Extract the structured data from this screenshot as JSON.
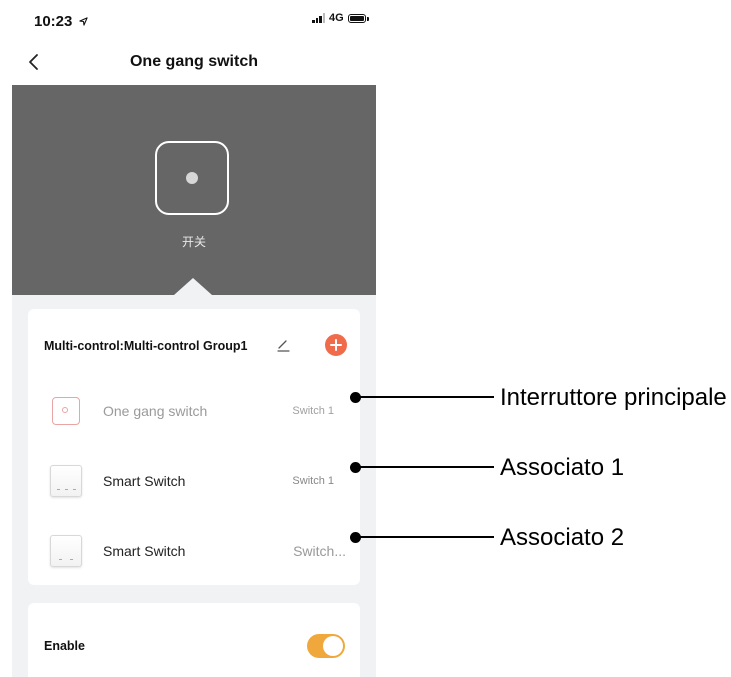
{
  "status_bar": {
    "time": "10:23",
    "location_icon": "location-arrow-icon",
    "signal_icon": "cellular-signal-icon",
    "network": "4G",
    "battery_icon": "battery-icon"
  },
  "nav": {
    "back_icon": "chevron-left-icon",
    "title": "One gang switch"
  },
  "hero": {
    "switch_label": "开关",
    "background_color": "#666666"
  },
  "group": {
    "title": "Multi-control:Multi-control Group1",
    "edit_icon": "pencil-icon",
    "add_icon": "plus-circle-icon",
    "accent_color": "#ef6b4a",
    "devices": [
      {
        "name": "One gang switch",
        "switch": "Switch 1"
      },
      {
        "name": "Smart Switch",
        "switch": "Switch 1"
      },
      {
        "name": "Smart Switch",
        "switch": "Switch..."
      }
    ]
  },
  "enable": {
    "label": "Enable",
    "toggle_on": true,
    "toggle_color": "#f0a83c"
  },
  "annotations": [
    {
      "label": "Interruttore principale"
    },
    {
      "label": "Associato 1"
    },
    {
      "label": "Associato 2"
    }
  ]
}
